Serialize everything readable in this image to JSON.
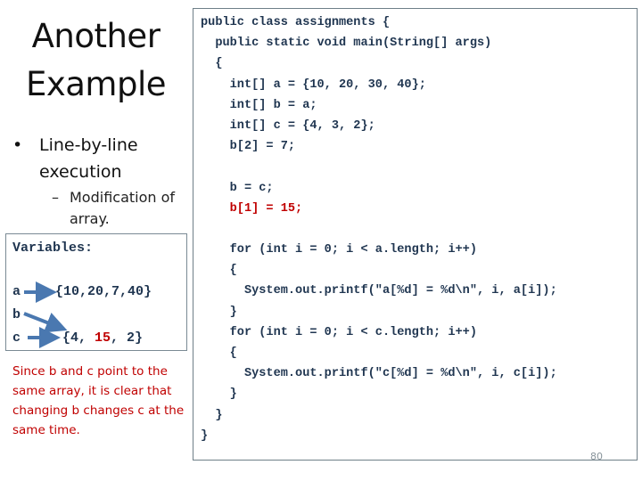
{
  "slide": {
    "title_line1": "Another",
    "title_line2": "Example",
    "bullet_symbol": "•",
    "bullet_text": "Line-by-line execution",
    "subbullet_symbol": "–",
    "subbullet_text": "Modification of array.",
    "page_number": "80"
  },
  "variables": {
    "heading": "Variables:",
    "a_label": "a",
    "a_value": "{10,20,7,40}",
    "b_label": "b",
    "c_label": "c",
    "c_value_prefix": "{4, ",
    "c_value_highlight": "15",
    "c_value_suffix": ", 2}"
  },
  "note": "Since b and c point to the same array, it is clear that changing b changes c at the same time.",
  "code": {
    "lines": [
      {
        "text": "public class assignments {",
        "highlight": false
      },
      {
        "text": "  public static void main(String[] args)",
        "highlight": false
      },
      {
        "text": "  {",
        "highlight": false
      },
      {
        "text": "    int[] a = {10, 20, 30, 40};",
        "highlight": false
      },
      {
        "text": "    int[] b = a;",
        "highlight": false
      },
      {
        "text": "    int[] c = {4, 3, 2};",
        "highlight": false
      },
      {
        "text": "    b[2] = 7;",
        "highlight": false
      },
      {
        "text": "",
        "highlight": false
      },
      {
        "text": "    b = c;",
        "highlight": false
      },
      {
        "text": "    b[1] = 15;",
        "highlight": true
      },
      {
        "text": "",
        "highlight": false
      },
      {
        "text": "    for (int i = 0; i < a.length; i++)",
        "highlight": false
      },
      {
        "text": "    {",
        "highlight": false
      },
      {
        "text": "      System.out.printf(\"a[%d] = %d\\n\", i, a[i]);",
        "highlight": false
      },
      {
        "text": "    }",
        "highlight": false
      },
      {
        "text": "    for (int i = 0; i < c.length; i++)",
        "highlight": false
      },
      {
        "text": "    {",
        "highlight": false
      },
      {
        "text": "      System.out.printf(\"c[%d] = %d\\n\", i, c[i]);",
        "highlight": false
      },
      {
        "text": "    }",
        "highlight": false
      },
      {
        "text": "  }",
        "highlight": false
      },
      {
        "text": "}",
        "highlight": false
      }
    ]
  },
  "colors": {
    "code_text": "#1f3550",
    "highlight": "#c00000",
    "arrow": "#4a78b0",
    "border": "#6f7f88"
  }
}
